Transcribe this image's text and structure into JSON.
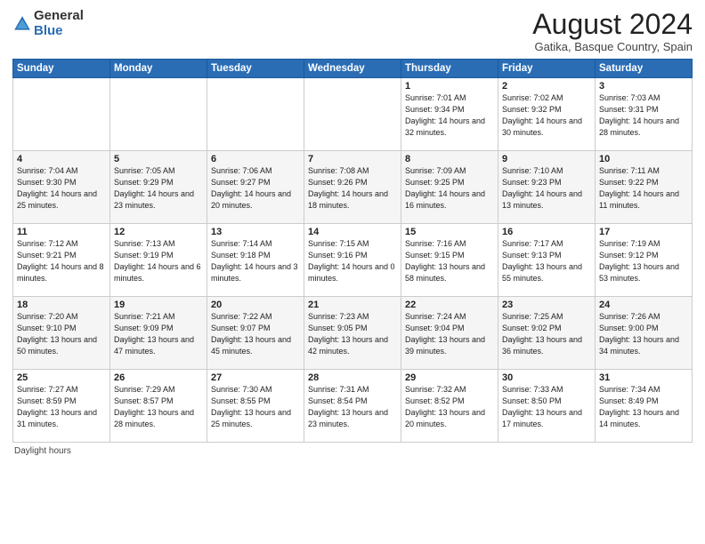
{
  "header": {
    "logo_general": "General",
    "logo_blue": "Blue",
    "month_year": "August 2024",
    "location": "Gatika, Basque Country, Spain"
  },
  "days_of_week": [
    "Sunday",
    "Monday",
    "Tuesday",
    "Wednesday",
    "Thursday",
    "Friday",
    "Saturday"
  ],
  "weeks": [
    [
      {
        "day": "",
        "sunrise": "",
        "sunset": "",
        "daylight": ""
      },
      {
        "day": "",
        "sunrise": "",
        "sunset": "",
        "daylight": ""
      },
      {
        "day": "",
        "sunrise": "",
        "sunset": "",
        "daylight": ""
      },
      {
        "day": "",
        "sunrise": "",
        "sunset": "",
        "daylight": ""
      },
      {
        "day": "1",
        "sunrise": "Sunrise: 7:01 AM",
        "sunset": "Sunset: 9:34 PM",
        "daylight": "Daylight: 14 hours and 32 minutes."
      },
      {
        "day": "2",
        "sunrise": "Sunrise: 7:02 AM",
        "sunset": "Sunset: 9:32 PM",
        "daylight": "Daylight: 14 hours and 30 minutes."
      },
      {
        "day": "3",
        "sunrise": "Sunrise: 7:03 AM",
        "sunset": "Sunset: 9:31 PM",
        "daylight": "Daylight: 14 hours and 28 minutes."
      }
    ],
    [
      {
        "day": "4",
        "sunrise": "Sunrise: 7:04 AM",
        "sunset": "Sunset: 9:30 PM",
        "daylight": "Daylight: 14 hours and 25 minutes."
      },
      {
        "day": "5",
        "sunrise": "Sunrise: 7:05 AM",
        "sunset": "Sunset: 9:29 PM",
        "daylight": "Daylight: 14 hours and 23 minutes."
      },
      {
        "day": "6",
        "sunrise": "Sunrise: 7:06 AM",
        "sunset": "Sunset: 9:27 PM",
        "daylight": "Daylight: 14 hours and 20 minutes."
      },
      {
        "day": "7",
        "sunrise": "Sunrise: 7:08 AM",
        "sunset": "Sunset: 9:26 PM",
        "daylight": "Daylight: 14 hours and 18 minutes."
      },
      {
        "day": "8",
        "sunrise": "Sunrise: 7:09 AM",
        "sunset": "Sunset: 9:25 PM",
        "daylight": "Daylight: 14 hours and 16 minutes."
      },
      {
        "day": "9",
        "sunrise": "Sunrise: 7:10 AM",
        "sunset": "Sunset: 9:23 PM",
        "daylight": "Daylight: 14 hours and 13 minutes."
      },
      {
        "day": "10",
        "sunrise": "Sunrise: 7:11 AM",
        "sunset": "Sunset: 9:22 PM",
        "daylight": "Daylight: 14 hours and 11 minutes."
      }
    ],
    [
      {
        "day": "11",
        "sunrise": "Sunrise: 7:12 AM",
        "sunset": "Sunset: 9:21 PM",
        "daylight": "Daylight: 14 hours and 8 minutes."
      },
      {
        "day": "12",
        "sunrise": "Sunrise: 7:13 AM",
        "sunset": "Sunset: 9:19 PM",
        "daylight": "Daylight: 14 hours and 6 minutes."
      },
      {
        "day": "13",
        "sunrise": "Sunrise: 7:14 AM",
        "sunset": "Sunset: 9:18 PM",
        "daylight": "Daylight: 14 hours and 3 minutes."
      },
      {
        "day": "14",
        "sunrise": "Sunrise: 7:15 AM",
        "sunset": "Sunset: 9:16 PM",
        "daylight": "Daylight: 14 hours and 0 minutes."
      },
      {
        "day": "15",
        "sunrise": "Sunrise: 7:16 AM",
        "sunset": "Sunset: 9:15 PM",
        "daylight": "Daylight: 13 hours and 58 minutes."
      },
      {
        "day": "16",
        "sunrise": "Sunrise: 7:17 AM",
        "sunset": "Sunset: 9:13 PM",
        "daylight": "Daylight: 13 hours and 55 minutes."
      },
      {
        "day": "17",
        "sunrise": "Sunrise: 7:19 AM",
        "sunset": "Sunset: 9:12 PM",
        "daylight": "Daylight: 13 hours and 53 minutes."
      }
    ],
    [
      {
        "day": "18",
        "sunrise": "Sunrise: 7:20 AM",
        "sunset": "Sunset: 9:10 PM",
        "daylight": "Daylight: 13 hours and 50 minutes."
      },
      {
        "day": "19",
        "sunrise": "Sunrise: 7:21 AM",
        "sunset": "Sunset: 9:09 PM",
        "daylight": "Daylight: 13 hours and 47 minutes."
      },
      {
        "day": "20",
        "sunrise": "Sunrise: 7:22 AM",
        "sunset": "Sunset: 9:07 PM",
        "daylight": "Daylight: 13 hours and 45 minutes."
      },
      {
        "day": "21",
        "sunrise": "Sunrise: 7:23 AM",
        "sunset": "Sunset: 9:05 PM",
        "daylight": "Daylight: 13 hours and 42 minutes."
      },
      {
        "day": "22",
        "sunrise": "Sunrise: 7:24 AM",
        "sunset": "Sunset: 9:04 PM",
        "daylight": "Daylight: 13 hours and 39 minutes."
      },
      {
        "day": "23",
        "sunrise": "Sunrise: 7:25 AM",
        "sunset": "Sunset: 9:02 PM",
        "daylight": "Daylight: 13 hours and 36 minutes."
      },
      {
        "day": "24",
        "sunrise": "Sunrise: 7:26 AM",
        "sunset": "Sunset: 9:00 PM",
        "daylight": "Daylight: 13 hours and 34 minutes."
      }
    ],
    [
      {
        "day": "25",
        "sunrise": "Sunrise: 7:27 AM",
        "sunset": "Sunset: 8:59 PM",
        "daylight": "Daylight: 13 hours and 31 minutes."
      },
      {
        "day": "26",
        "sunrise": "Sunrise: 7:29 AM",
        "sunset": "Sunset: 8:57 PM",
        "daylight": "Daylight: 13 hours and 28 minutes."
      },
      {
        "day": "27",
        "sunrise": "Sunrise: 7:30 AM",
        "sunset": "Sunset: 8:55 PM",
        "daylight": "Daylight: 13 hours and 25 minutes."
      },
      {
        "day": "28",
        "sunrise": "Sunrise: 7:31 AM",
        "sunset": "Sunset: 8:54 PM",
        "daylight": "Daylight: 13 hours and 23 minutes."
      },
      {
        "day": "29",
        "sunrise": "Sunrise: 7:32 AM",
        "sunset": "Sunset: 8:52 PM",
        "daylight": "Daylight: 13 hours and 20 minutes."
      },
      {
        "day": "30",
        "sunrise": "Sunrise: 7:33 AM",
        "sunset": "Sunset: 8:50 PM",
        "daylight": "Daylight: 13 hours and 17 minutes."
      },
      {
        "day": "31",
        "sunrise": "Sunrise: 7:34 AM",
        "sunset": "Sunset: 8:49 PM",
        "daylight": "Daylight: 13 hours and 14 minutes."
      }
    ]
  ],
  "footer": {
    "daylight_label": "Daylight hours"
  }
}
